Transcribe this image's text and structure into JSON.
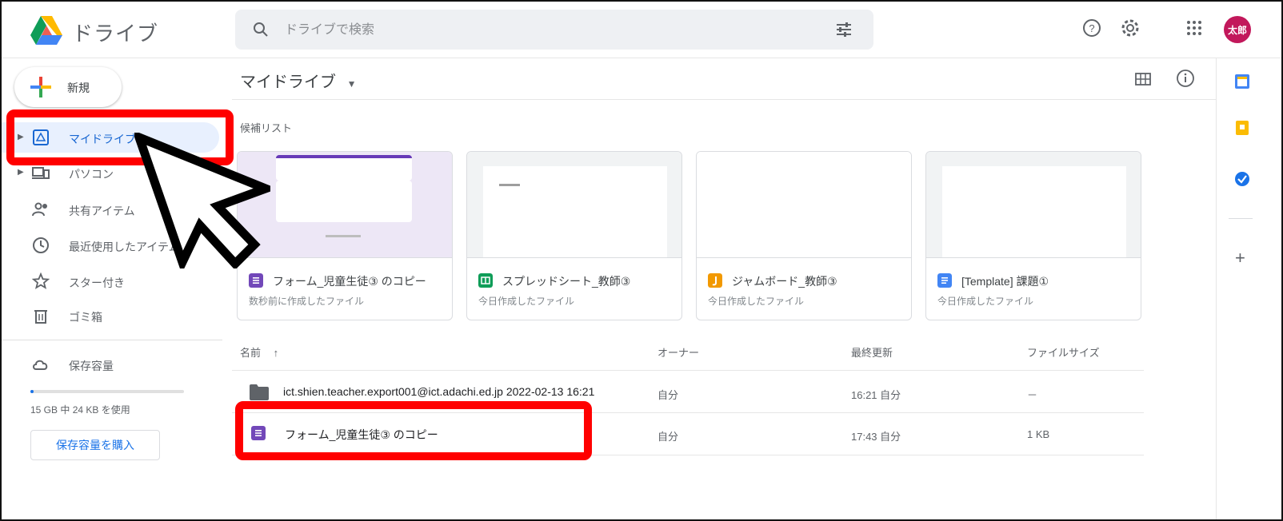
{
  "app": {
    "title": "ドライブ"
  },
  "search": {
    "placeholder": "ドライブで検索"
  },
  "user": {
    "avatar_text": "太郎",
    "avatar_color": "#c2185b"
  },
  "sidebar": {
    "new_button_label": "新規",
    "items": [
      {
        "label": "マイドライブ",
        "icon": "my-drive-icon",
        "active": true
      },
      {
        "label": "パソコン",
        "icon": "computer-icon"
      },
      {
        "label": "共有アイテム",
        "icon": "shared-icon"
      },
      {
        "label": "最近使用したアイテム",
        "icon": "clock-icon"
      },
      {
        "label": "スター付き",
        "icon": "star-icon"
      },
      {
        "label": "ゴミ箱",
        "icon": "trash-icon"
      }
    ],
    "storage_label": "保存容量",
    "storage_usage_text": "15 GB 中 24 KB を使用",
    "buy_storage_label": "保存容量を購入"
  },
  "main": {
    "breadcrumb": "マイドライブ",
    "suggested_label": "候補リスト",
    "cards": [
      {
        "title": "フォーム_児童生徒③ のコピー",
        "subtitle": "数秒前に作成したファイル",
        "icon": "forms-icon",
        "icon_color": "#7248b9"
      },
      {
        "title": "スプレッドシート_教師③",
        "subtitle": "今日作成したファイル",
        "icon": "sheets-icon",
        "icon_color": "#0f9d58"
      },
      {
        "title": "ジャムボード_教師③",
        "subtitle": "今日作成したファイル",
        "icon": "jamboard-icon",
        "icon_color": "#f29900"
      },
      {
        "title": "[Template] 課題①",
        "subtitle": "今日作成したファイル",
        "icon": "docs-icon",
        "icon_color": "#4285f4"
      }
    ],
    "table": {
      "headers": {
        "name": "名前",
        "owner": "オーナー",
        "modified": "最終更新",
        "size": "ファイルサイズ"
      },
      "rows": [
        {
          "name": "ict.shien.teacher.export001@ict.adachi.ed.jp 2022-02-13 16:21",
          "owner": "自分",
          "modified": "16:21 自分",
          "size": "－",
          "icon": "folder-icon"
        },
        {
          "name": "フォーム_児童生徒③ のコピー",
          "owner": "自分",
          "modified": "17:43 自分",
          "size": "1 KB",
          "icon": "forms-icon"
        }
      ]
    }
  },
  "colors": {
    "accent": "#1a73e8",
    "highlight_box": "#ff0000",
    "active_nav_bg": "#e8f0fe"
  }
}
